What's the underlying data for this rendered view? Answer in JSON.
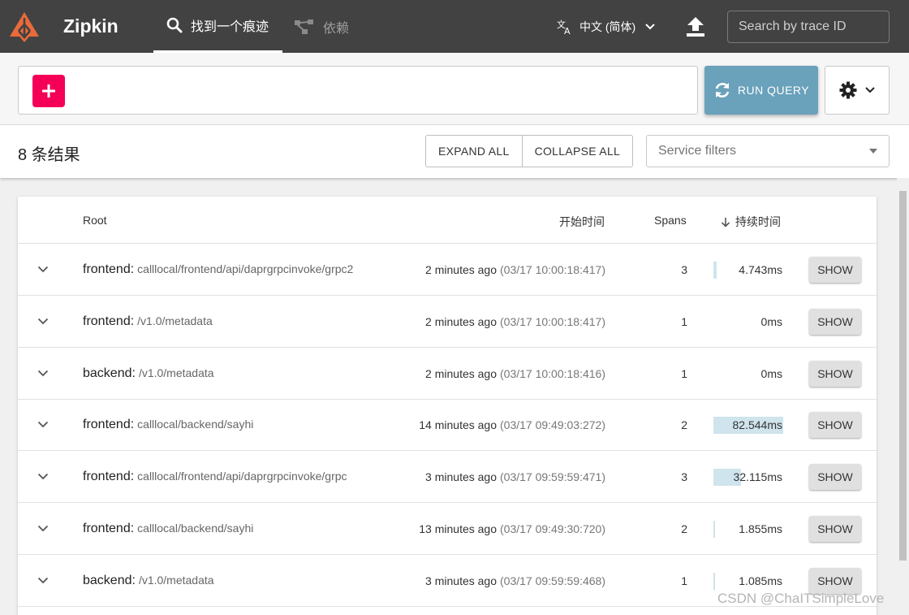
{
  "header": {
    "brand": "Zipkin",
    "nav": [
      {
        "label": "找到一个痕迹",
        "icon": "search-icon",
        "active": true
      },
      {
        "label": "依赖",
        "icon": "dependencies-icon",
        "active": false
      }
    ],
    "language": "中文 (简体)",
    "trace_search_placeholder": "Search by trace ID"
  },
  "query": {
    "run_label": "RUN QUERY"
  },
  "results": {
    "count_label": "8 条结果",
    "expand_all": "EXPAND ALL",
    "collapse_all": "COLLAPSE ALL",
    "service_filter_placeholder": "Service filters"
  },
  "table": {
    "headers": {
      "root": "Root",
      "start": "开始时间",
      "spans": "Spans",
      "duration": "持续时间"
    },
    "rows": [
      {
        "service": "frontend:",
        "path": "calllocal/frontend/api/daprgrpcinvoke/grpc2",
        "relative": "2 minutes ago",
        "absolute": "(03/17 10:00:18:417)",
        "spans": "3",
        "duration": "4.743ms",
        "duration_fraction": 0.05,
        "action": "SHOW"
      },
      {
        "service": "frontend:",
        "path": "/v1.0/metadata",
        "relative": "2 minutes ago",
        "absolute": "(03/17 10:00:18:417)",
        "spans": "1",
        "duration": "0ms",
        "duration_fraction": 0,
        "action": "SHOW"
      },
      {
        "service": "backend:",
        "path": "/v1.0/metadata",
        "relative": "2 minutes ago",
        "absolute": "(03/17 10:00:18:416)",
        "spans": "1",
        "duration": "0ms",
        "duration_fraction": 0,
        "action": "SHOW"
      },
      {
        "service": "frontend:",
        "path": "calllocal/backend/sayhi",
        "relative": "14 minutes ago",
        "absolute": "(03/17 09:49:03:272)",
        "spans": "2",
        "duration": "82.544ms",
        "duration_fraction": 1.0,
        "action": "SHOW"
      },
      {
        "service": "frontend:",
        "path": "calllocal/frontend/api/daprgrpcinvoke/grpc",
        "relative": "3 minutes ago",
        "absolute": "(03/17 09:59:59:471)",
        "spans": "3",
        "duration": "32.115ms",
        "duration_fraction": 0.39,
        "action": "SHOW"
      },
      {
        "service": "frontend:",
        "path": "calllocal/backend/sayhi",
        "relative": "13 minutes ago",
        "absolute": "(03/17 09:49:30:720)",
        "spans": "2",
        "duration": "1.855ms",
        "duration_fraction": 0.02,
        "action": "SHOW"
      },
      {
        "service": "backend:",
        "path": "/v1.0/metadata",
        "relative": "3 minutes ago",
        "absolute": "(03/17 09:59:59:468)",
        "spans": "1",
        "duration": "1.085ms",
        "duration_fraction": 0.013,
        "action": "SHOW"
      }
    ]
  },
  "watermark": "CSDN @ChaITSimpleLove",
  "colors": {
    "topbar": "#424242",
    "accent_add": "#f50057",
    "run_query": "#6aa1bb",
    "duration_bar": "#cfe4ec",
    "logo": "#ea6b3a"
  }
}
